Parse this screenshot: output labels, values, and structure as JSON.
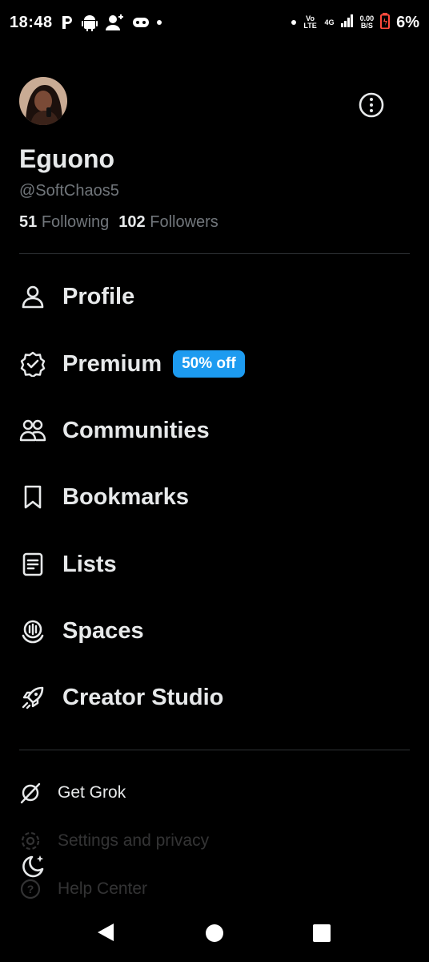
{
  "status_bar": {
    "time": "18:48",
    "network_type": "Vo LTE",
    "signal_label": "4G",
    "speed_value": "0.00",
    "speed_unit": "B/S",
    "battery_percent": "6%"
  },
  "profile": {
    "name": "Eguono",
    "handle": "@SoftChaos5",
    "following_count": "51",
    "following_label": "Following",
    "followers_count": "102",
    "followers_label": "Followers"
  },
  "menu": {
    "profile": "Profile",
    "premium": "Premium",
    "premium_badge": "50% off",
    "communities": "Communities",
    "bookmarks": "Bookmarks",
    "lists": "Lists",
    "spaces": "Spaces",
    "creator_studio": "Creator Studio"
  },
  "secondary": {
    "get_grok": "Get Grok",
    "settings": "Settings and privacy",
    "help": "Help Center"
  },
  "colors": {
    "background": "#000000",
    "text": "#e7e9ea",
    "muted": "#71767b",
    "accent": "#1d9bf0",
    "divider": "#2f3336"
  },
  "icons": {
    "profile": "person-icon",
    "premium": "verified-badge-icon",
    "communities": "people-icon",
    "bookmarks": "bookmark-icon",
    "lists": "list-icon",
    "spaces": "microphone-icon",
    "creator_studio": "rocket-icon",
    "grok": "grok-icon",
    "settings": "gear-icon",
    "help": "help-icon",
    "theme": "moon-icon"
  }
}
